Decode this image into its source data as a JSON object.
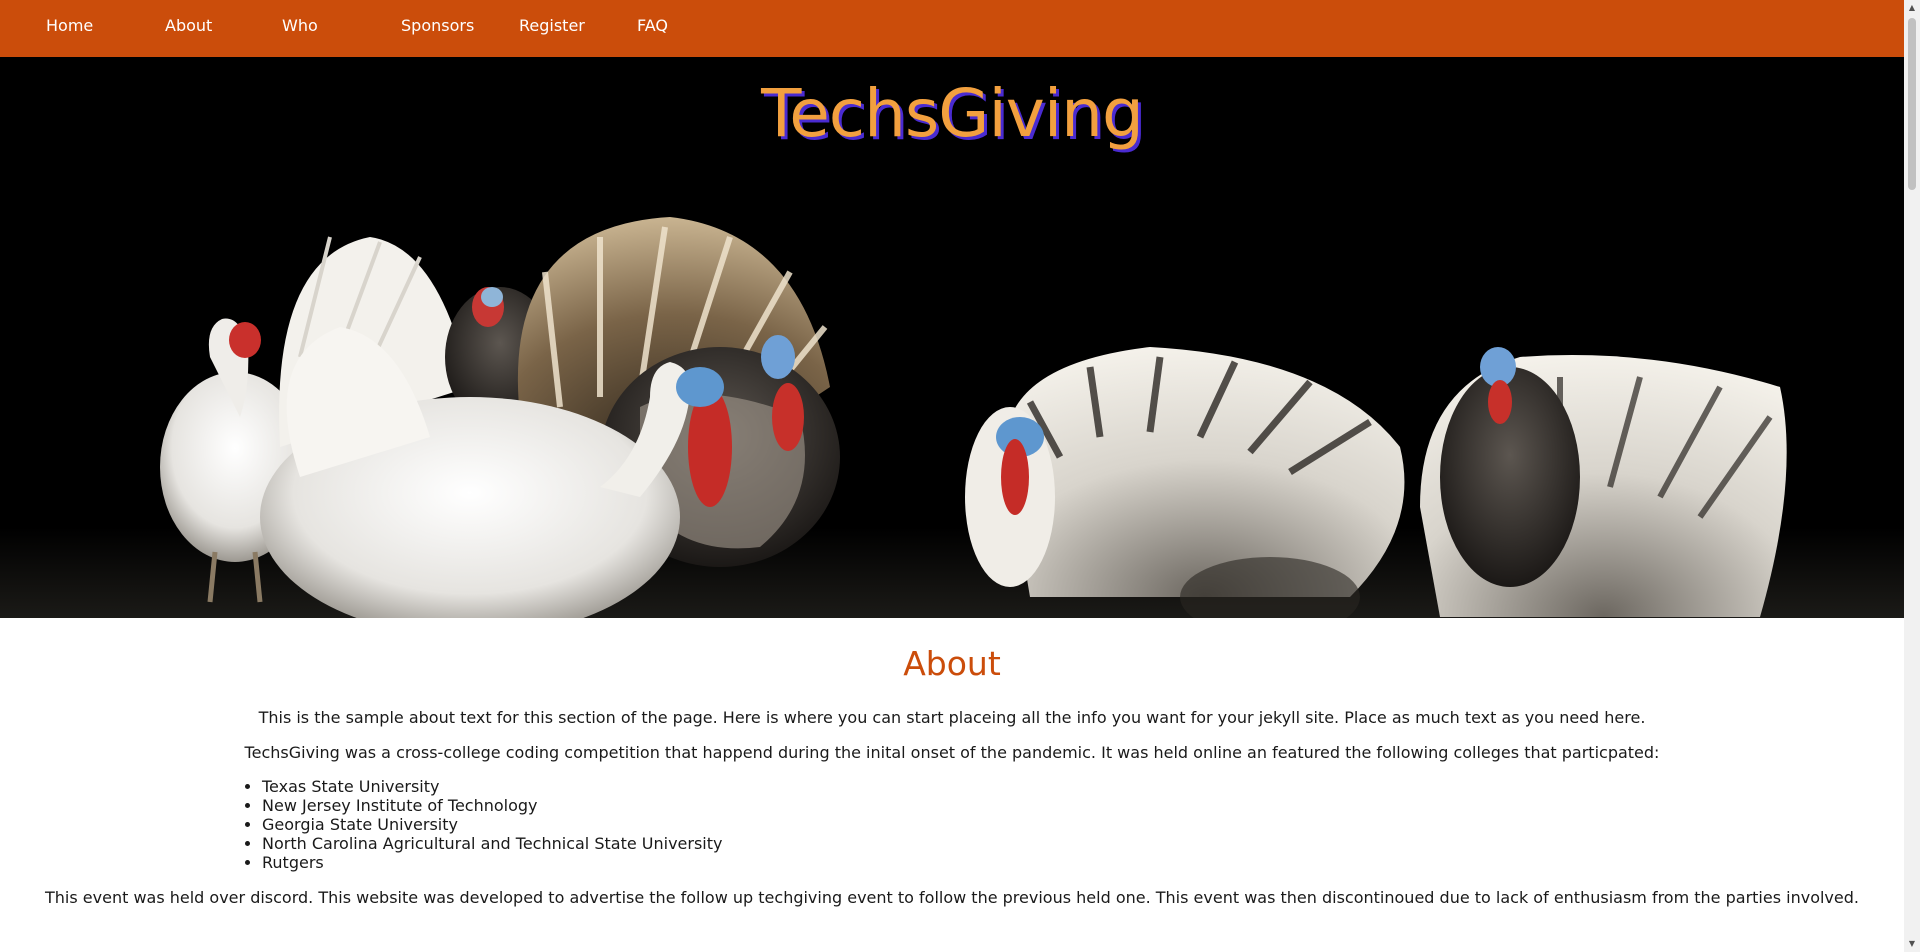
{
  "nav": {
    "items": [
      {
        "label": "Home"
      },
      {
        "label": "About"
      },
      {
        "label": "Who"
      },
      {
        "label": "Sponsors"
      },
      {
        "label": "Register"
      },
      {
        "label": "FAQ"
      }
    ]
  },
  "hero": {
    "title": "TechsGiving",
    "image": "turkeys-photo"
  },
  "about": {
    "heading": "About",
    "paragraph1": "This is the sample about text for this section of the page. Here is where you can start placeing all the info you want for your jekyll site. Place as much text as you need here.",
    "paragraph2": "TechsGiving was a cross-college coding competition that happend during the inital onset of the pandemic. It was held online an featured the following colleges that particpated:",
    "colleges": [
      "Texas State University",
      "New Jersey Institute of Technology",
      "Georgia State University",
      "North Carolina Agricultural and Technical State University",
      "Rutgers"
    ],
    "paragraph3": "This event was held over discord. This website was developed to advertise the follow up techgiving event to follow the previous held one. This event was then discontinoued due to lack of enthusiasm from the parties involved."
  },
  "colors": {
    "nav_bg": "#cb4d0b",
    "title": "#f2a03f",
    "title_shadow": "#4a2bd1",
    "heading": "#cb4d0b"
  },
  "icons": {
    "scroll_up": "scroll-up-arrow-icon",
    "scroll_down": "scroll-down-arrow-icon"
  }
}
